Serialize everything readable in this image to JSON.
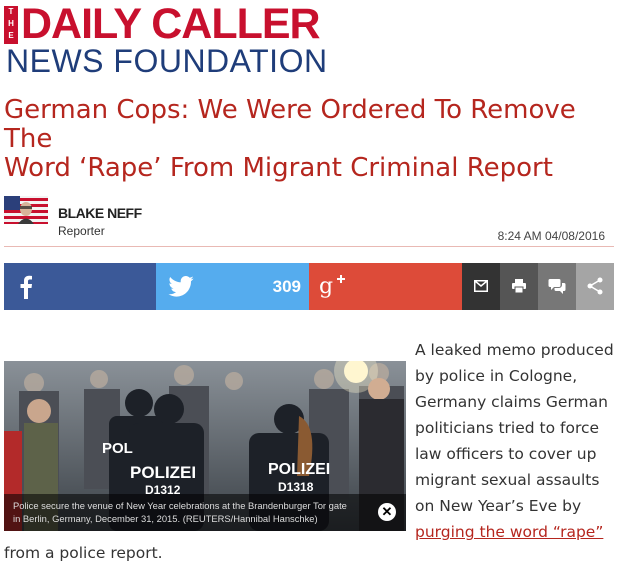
{
  "logo": {
    "the": "THE",
    "line1": "DAILY CALLER",
    "line2": "NEWS FOUNDATION"
  },
  "article": {
    "headline_line1": "German Cops: We Were Ordered To Remove The",
    "headline_line2": "Word ‘Rape’ From Migrant Criminal Report"
  },
  "author": {
    "name": "BLAKE NEFF",
    "role": "Reporter",
    "timestamp": "8:24 AM 04/08/2016"
  },
  "share": {
    "twitter_count": "309",
    "icons": [
      "facebook-icon",
      "twitter-icon",
      "google-plus-icon",
      "mail-icon",
      "print-icon",
      "comments-icon",
      "share-icon"
    ],
    "colors": {
      "facebook": "#3b5998",
      "twitter": "#55acee",
      "google_plus": "#dd4b39"
    }
  },
  "image": {
    "caption_line1": "Police secure the venue of New Year celebrations at the Brandenburger Tor gate",
    "caption_line2": "in Berlin, Germany, December 31, 2015. (REUTERS/Hannibal Hanschke)",
    "vest_left": "POLIZEI",
    "vest_left_id": "D1312",
    "vest_right": "POLIZEI",
    "vest_right_id": "D1318",
    "vest_far_left": "POL"
  },
  "body": {
    "lines": [
      "A leaked memo produced",
      "by police in Cologne,",
      "Germany claims German",
      "politicians tried to force",
      "law officers to cover up",
      "migrant sexual assaults",
      "on New Year’s Eve by"
    ],
    "link_text": "purging the word “rape”",
    "tail": "from a police report."
  },
  "theme": {
    "accent": "#b5261e",
    "brand_blue": "#1f3d7a"
  }
}
